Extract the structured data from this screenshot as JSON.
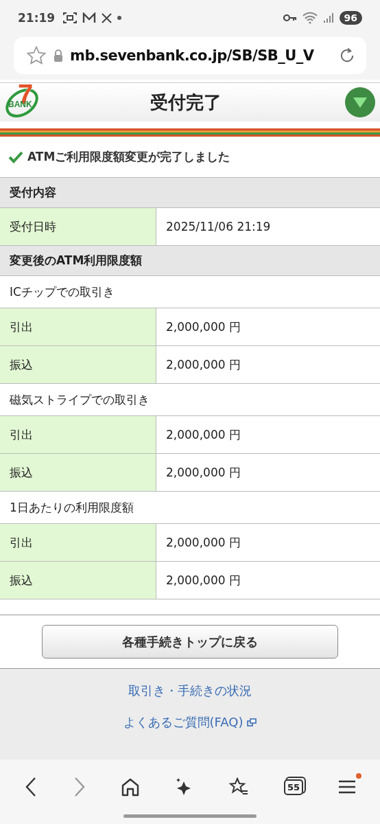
{
  "status_bar": {
    "time": "21:19",
    "battery": "96"
  },
  "browser": {
    "url": "mb.sevenbank.co.jp/SB/SB_U_V",
    "tab_count": "55"
  },
  "header": {
    "logo_digit": "7",
    "logo_text": "BANK",
    "title": "受付完了"
  },
  "message": "ATMご利用限度額変更が完了しました",
  "items": [
    {
      "kind": "heading",
      "text": "受付内容"
    },
    {
      "kind": "row",
      "label": "受付日時",
      "value": "2025/11/06 21:19"
    },
    {
      "kind": "heading",
      "text": "変更後のATM利用限度額"
    },
    {
      "kind": "subheading",
      "text": "ICチップでの取引き"
    },
    {
      "kind": "row",
      "label": "引出",
      "value": "2,000,000 円"
    },
    {
      "kind": "row",
      "label": "振込",
      "value": "2,000,000 円"
    },
    {
      "kind": "subheading",
      "text": "磁気ストライプでの取引き"
    },
    {
      "kind": "row",
      "label": "引出",
      "value": "2,000,000 円"
    },
    {
      "kind": "row",
      "label": "振込",
      "value": "2,000,000 円"
    },
    {
      "kind": "subheading",
      "text": "1日あたりの利用限度額"
    },
    {
      "kind": "row",
      "label": "引出",
      "value": "2,000,000 円"
    },
    {
      "kind": "row",
      "label": "振込",
      "value": "2,000,000 円"
    }
  ],
  "back_button": "各種手続きトップに戻る",
  "footer_links": [
    {
      "text": "取引き・手続きの状況",
      "external": false
    },
    {
      "text": "よくあるご質問(FAQ)",
      "external": true
    }
  ]
}
